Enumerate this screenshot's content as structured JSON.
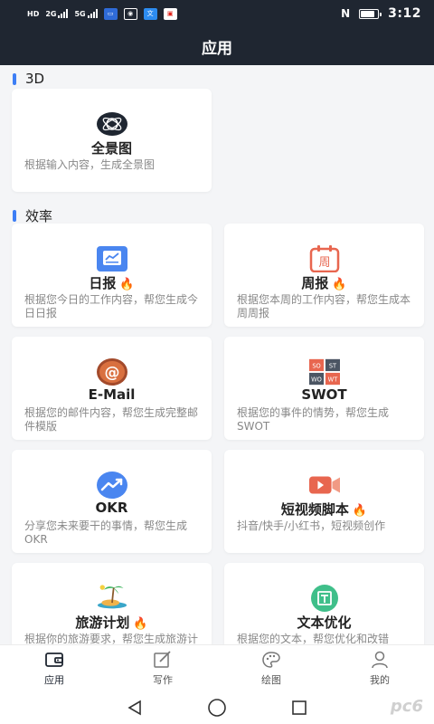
{
  "status_bar": {
    "time": "3:12",
    "signal_left": "HD",
    "net1": "2G",
    "net2": "5G",
    "app_icons": [
      "card-app-icon",
      "eye-app-icon",
      "translate-app-icon",
      "shop-app-icon"
    ],
    "nfc_icon": "nfc-icon",
    "battery_level": 0.85
  },
  "header": {
    "title": "应用"
  },
  "sections": [
    {
      "title": "3D",
      "cards": [
        {
          "icon": "sphere-icon",
          "title": "全景图",
          "hot": false,
          "desc": "根据输入内容，生成全景图"
        }
      ]
    },
    {
      "title": "效率",
      "cards": [
        {
          "icon": "daily-report-icon",
          "title": "日报",
          "hot": true,
          "desc": "根据您今日的工作内容，帮您生成今日日报"
        },
        {
          "icon": "weekly-report-icon",
          "title": "周报",
          "hot": true,
          "desc": "根据您本周的工作内容，帮您生成本周周报"
        },
        {
          "icon": "email-icon",
          "title": "E-Mail",
          "hot": false,
          "desc": "根据您的邮件内容，帮您生成完整邮件模版"
        },
        {
          "icon": "swot-icon",
          "title": "SWOT",
          "hot": false,
          "desc": "根据您的事件的情势，帮您生成 SWOT"
        },
        {
          "icon": "okr-icon",
          "title": "OKR",
          "hot": false,
          "desc": "分享您未来要干的事情，帮您生成 OKR"
        },
        {
          "icon": "video-script-icon",
          "title": "短视频脚本",
          "hot": true,
          "desc": "抖音/快手/小红书，短视频创作"
        },
        {
          "icon": "travel-icon",
          "title": "旅游计划",
          "hot": true,
          "desc": "根据你的旅游要求，帮您生成旅游计划"
        },
        {
          "icon": "text-optimize-icon",
          "title": "文本优化",
          "hot": false,
          "desc": "根据您的文本，帮您优化和改错"
        }
      ]
    }
  ],
  "weekly_icon_char": "周",
  "swot_labels": [
    "SO",
    "ST",
    "WO",
    "WT"
  ],
  "hot_glyph": "🔥",
  "bottom_nav": [
    {
      "label": "应用",
      "icon": "wallet-icon",
      "active": true
    },
    {
      "label": "写作",
      "icon": "edit-icon",
      "active": false
    },
    {
      "label": "绘图",
      "icon": "palette-icon",
      "active": false
    },
    {
      "label": "我的",
      "icon": "user-icon",
      "active": false
    }
  ],
  "watermark": "pc6",
  "colors": {
    "header_bg": "#1f2631",
    "accent": "#3d7ef5",
    "hot": "#ff6a00"
  }
}
